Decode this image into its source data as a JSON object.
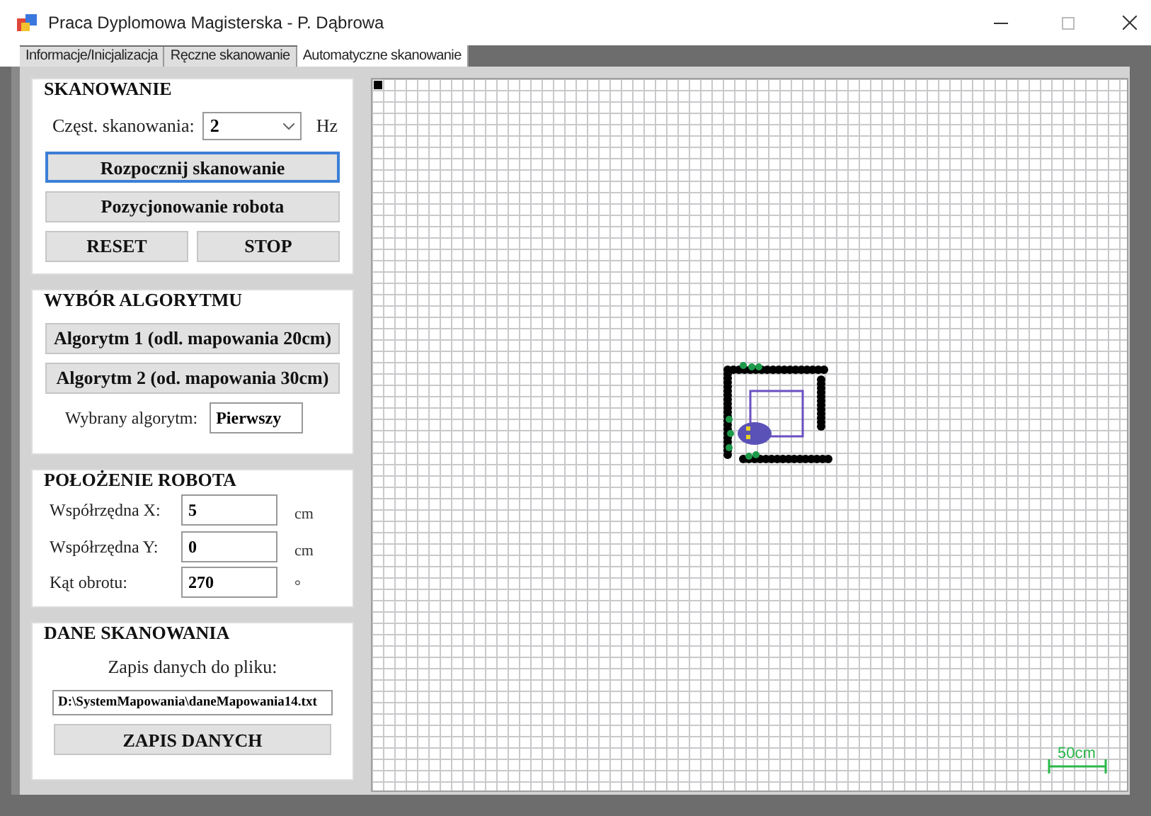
{
  "window": {
    "title": "Praca Dyplomowa Magisterska - P. Dąbrowa"
  },
  "tabs": [
    {
      "label": "Informacje/Inicjalizacja",
      "selected": false
    },
    {
      "label": "Ręczne skanowanie",
      "selected": false
    },
    {
      "label": "Automatyczne skanowanie",
      "selected": true
    }
  ],
  "scanning": {
    "title": "SKANOWANIE",
    "freq_label": "Częst. skanowania:",
    "freq_value": "2",
    "freq_unit": "Hz",
    "start_button": "Rozpocznij skanowanie",
    "position_button": "Pozycjonowanie robota",
    "reset_button": "RESET",
    "stop_button": "STOP"
  },
  "algorithm": {
    "title": "WYBÓR ALGORYTMU",
    "buttons": [
      "Algorytm 1 (odl. mapowania 20cm)",
      "Algorytm 2 (od. mapowania 30cm)"
    ],
    "selected_label": "Wybrany algorytm:",
    "selected_value": "Pierwszy"
  },
  "position": {
    "title": "POŁOŻENIE ROBOTA",
    "fields": [
      {
        "label": "Współrzędna X:",
        "value": "5",
        "unit": "cm"
      },
      {
        "label": "Współrzędna Y:",
        "value": "0",
        "unit": "cm"
      },
      {
        "label": "Kąt obrotu:",
        "value": "270",
        "unit": "°"
      }
    ]
  },
  "data": {
    "title": "DANE SKANOWANIA",
    "file_label": "Zapis danych do pliku:",
    "file_path": "D:\\SystemMapowania\\daneMapowania14.txt",
    "save_button": "ZAPIS DANYCH"
  },
  "map": {
    "scale_label": "50cm"
  }
}
